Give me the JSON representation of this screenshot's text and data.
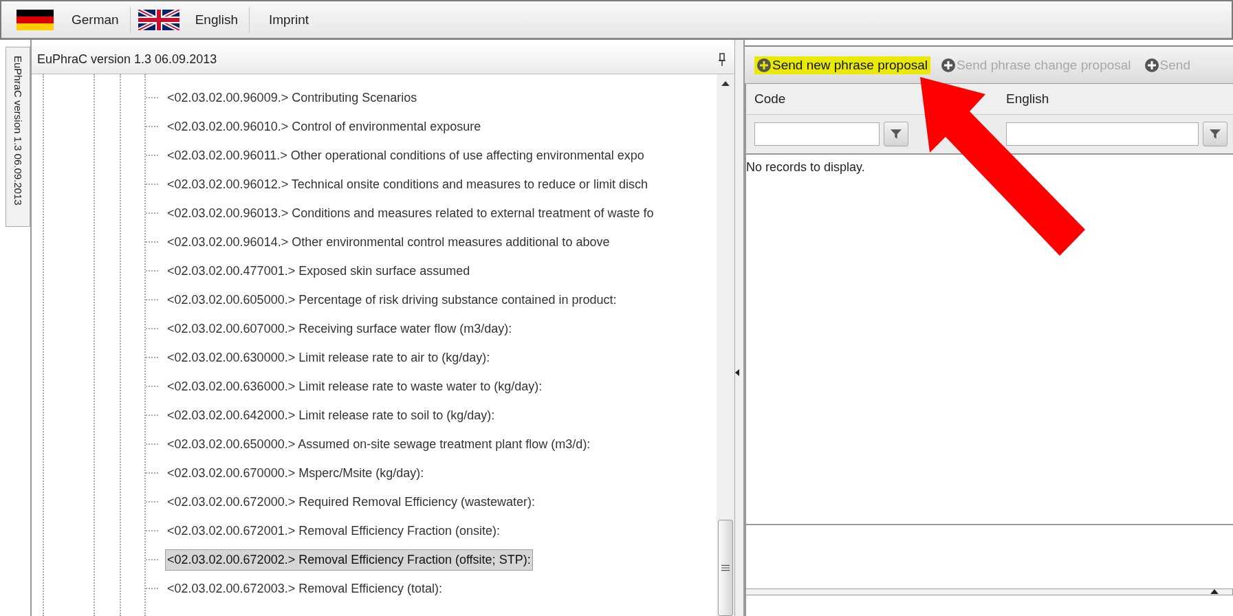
{
  "languages": [
    {
      "label": "German",
      "kind": "de"
    },
    {
      "label": "English",
      "kind": "gb"
    }
  ],
  "imprint": "Imprint",
  "side_tab": "EuPhraC version 1.3 06.09.2013",
  "tree": {
    "title": "EuPhraC version 1.3 06.09.2013",
    "items": [
      {
        "code": "<02.03.02.00.96009.>",
        "label": "Contributing Scenarios",
        "selected": false
      },
      {
        "code": "<02.03.02.00.96010.>",
        "label": "Control of environmental exposure",
        "selected": false
      },
      {
        "code": "<02.03.02.00.96011.>",
        "label": "Other operational conditions of use affecting environmental expo",
        "selected": false
      },
      {
        "code": "<02.03.02.00.96012.>",
        "label": "Technical onsite conditions and measures to reduce or limit disch",
        "selected": false
      },
      {
        "code": "<02.03.02.00.96013.>",
        "label": "Conditions and measures related to external treatment of waste fo",
        "selected": false
      },
      {
        "code": "<02.03.02.00.96014.>",
        "label": "Other environmental control measures additional to above",
        "selected": false
      },
      {
        "code": "<02.03.02.00.477001.>",
        "label": "Exposed skin surface assumed",
        "selected": false
      },
      {
        "code": "<02.03.02.00.605000.>",
        "label": "Percentage of risk driving substance contained in product:",
        "selected": false
      },
      {
        "code": "<02.03.02.00.607000.>",
        "label": "Receiving surface water flow (m3/day):",
        "selected": false
      },
      {
        "code": "<02.03.02.00.630000.>",
        "label": "Limit release rate to air to (kg/day):",
        "selected": false
      },
      {
        "code": "<02.03.02.00.636000.>",
        "label": "Limit release rate to waste water to (kg/day):",
        "selected": false
      },
      {
        "code": "<02.03.02.00.642000.>",
        "label": "Limit release rate to soil to (kg/day):",
        "selected": false
      },
      {
        "code": "<02.03.02.00.650000.>",
        "label": "Assumed on-site sewage treatment plant flow (m3/d):",
        "selected": false
      },
      {
        "code": "<02.03.02.00.670000.>",
        "label": "Msperc/Msite (kg/day):",
        "selected": false
      },
      {
        "code": "<02.03.02.00.672000.>",
        "label": "Required Removal Efficiency (wastewater):",
        "selected": false
      },
      {
        "code": "<02.03.02.00.672001.>",
        "label": "Removal Efficiency Fraction (onsite):",
        "selected": false
      },
      {
        "code": "<02.03.02.00.672002.>",
        "label": "Removal Efficiency Fraction (offsite; STP):",
        "selected": true
      },
      {
        "code": "<02.03.02.00.672003.>",
        "label": "Removal Efficiency (total):",
        "selected": false
      }
    ]
  },
  "toolbar": [
    {
      "label": "Send new phrase proposal",
      "disabled": false,
      "highlighted": true
    },
    {
      "label": "Send phrase change proposal",
      "disabled": true,
      "highlighted": false
    },
    {
      "label": "Send",
      "disabled": true,
      "highlighted": false
    }
  ],
  "grid": {
    "columns": [
      {
        "header": "Code"
      },
      {
        "header": "English"
      }
    ],
    "empty_text": "No records to display."
  }
}
